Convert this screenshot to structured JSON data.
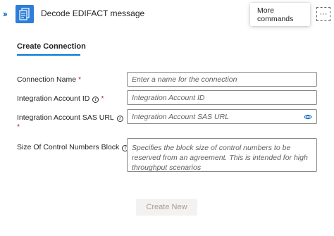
{
  "header": {
    "title": "Decode EDIFACT message",
    "expand_chevron": "››",
    "more_commands_tooltip": "More commands",
    "more_button_glyph": "···",
    "icon_color": "#2d7ed8"
  },
  "tabs": [
    {
      "label": "Create Connection",
      "active": true
    }
  ],
  "form": {
    "connection_name": {
      "label": "Connection Name",
      "required": "*",
      "placeholder": "Enter a name for the connection"
    },
    "integration_account_id": {
      "label": "Integration Account ID",
      "required": "*",
      "placeholder": "Integration Account ID"
    },
    "integration_account_sas_url": {
      "label": "Integration Account SAS URL",
      "required": "*",
      "placeholder": "Integration Account SAS URL"
    },
    "control_numbers_block": {
      "label": "Size Of Control Numbers Block",
      "placeholder": "Specifies the block size of control numbers to be reserved from an agreement. This is intended for high throughput scenarios"
    }
  },
  "actions": {
    "create_label": "Create New"
  },
  "colors": {
    "accent": "#0078d4",
    "required": "#a4262c",
    "disabled_button_bg": "#f3f2f1"
  }
}
